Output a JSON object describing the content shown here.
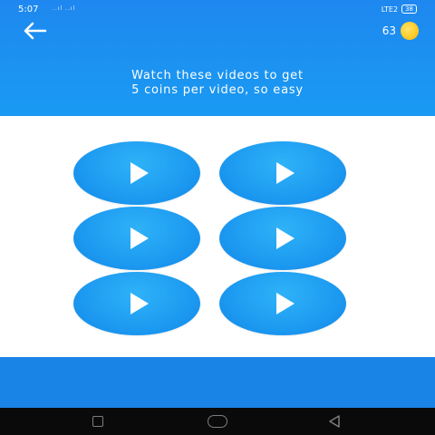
{
  "status_bar": {
    "time": "5:07",
    "signal": "..ıl ..ıl",
    "network": "LTE2",
    "battery": "38"
  },
  "header": {
    "back_icon": "arrow-left-icon",
    "coins": "63",
    "coin_icon": "coin-icon",
    "message_line1": "Watch these videos to get",
    "message_line2": "5 coins per video, so easy"
  },
  "videos": [
    {
      "icon": "play-icon"
    },
    {
      "icon": "play-icon"
    },
    {
      "icon": "play-icon"
    },
    {
      "icon": "play-icon"
    },
    {
      "icon": "play-icon"
    },
    {
      "icon": "play-icon"
    }
  ],
  "nav_bar": {
    "recents_icon": "square-icon",
    "home_icon": "circle-icon",
    "back_icon": "triangle-back-icon"
  },
  "colors": {
    "header_blue": "#1e88f0",
    "button_blue": "#1e9cf1",
    "footer_blue": "#1a84e6",
    "coin_gold": "#ffc61a"
  }
}
